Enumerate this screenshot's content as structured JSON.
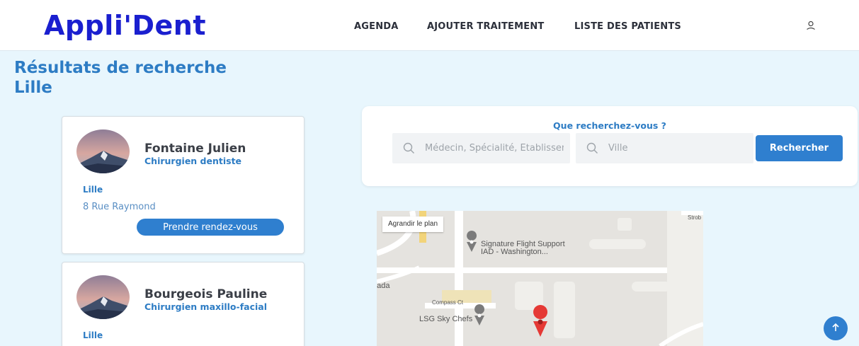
{
  "header": {
    "logo": "Appli'Dent",
    "nav": {
      "agenda": "AGENDA",
      "ajouter": "AJOUTER TRAITEMENT",
      "liste": "LISTE DES PATIENTS"
    },
    "user_icon": "user-icon"
  },
  "page": {
    "title_line1": "Résultats de recherche",
    "title_line2": "Lille"
  },
  "results": [
    {
      "name": "Fontaine Julien",
      "specialty": "Chirurgien dentiste",
      "city": "Lille",
      "address": "8 Rue Raymond",
      "button": "Prendre rendez-vous"
    },
    {
      "name": "Bourgeois Pauline",
      "specialty": "Chirurgien maxillo-facial",
      "city": "Lille"
    }
  ],
  "search": {
    "label": "Que recherchez-vous ?",
    "doctor_placeholder": "Médecin, Spécialité, Etablissement",
    "city_placeholder": "Ville",
    "button": "Rechercher"
  },
  "map": {
    "enlarge": "Agrandir le plan",
    "poi_1": "Signature Flight Support",
    "poi_1_sub": "IAD - Washington...",
    "poi_2": "LSG Sky Chefs",
    "street": "Compass Ct",
    "edge_left": "nada",
    "edge_top": "Strob"
  },
  "colors": {
    "primary": "#2f7fcf",
    "logo": "#1a1fcf",
    "background": "#e8f6fd"
  }
}
